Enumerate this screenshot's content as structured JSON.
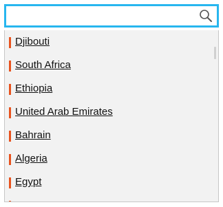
{
  "search": {
    "value": "",
    "placeholder": "",
    "icon": "search-icon"
  },
  "colors": {
    "accent_border": "#27b6ef",
    "item_marker": "#e8531e",
    "list_background": "#f2f2f2"
  },
  "list": {
    "items": [
      {
        "label": "Djibouti"
      },
      {
        "label": "South Africa"
      },
      {
        "label": "Ethiopia"
      },
      {
        "label": "United Arab Emirates"
      },
      {
        "label": "Bahrain"
      },
      {
        "label": "Algeria"
      },
      {
        "label": "Egypt"
      }
    ]
  }
}
